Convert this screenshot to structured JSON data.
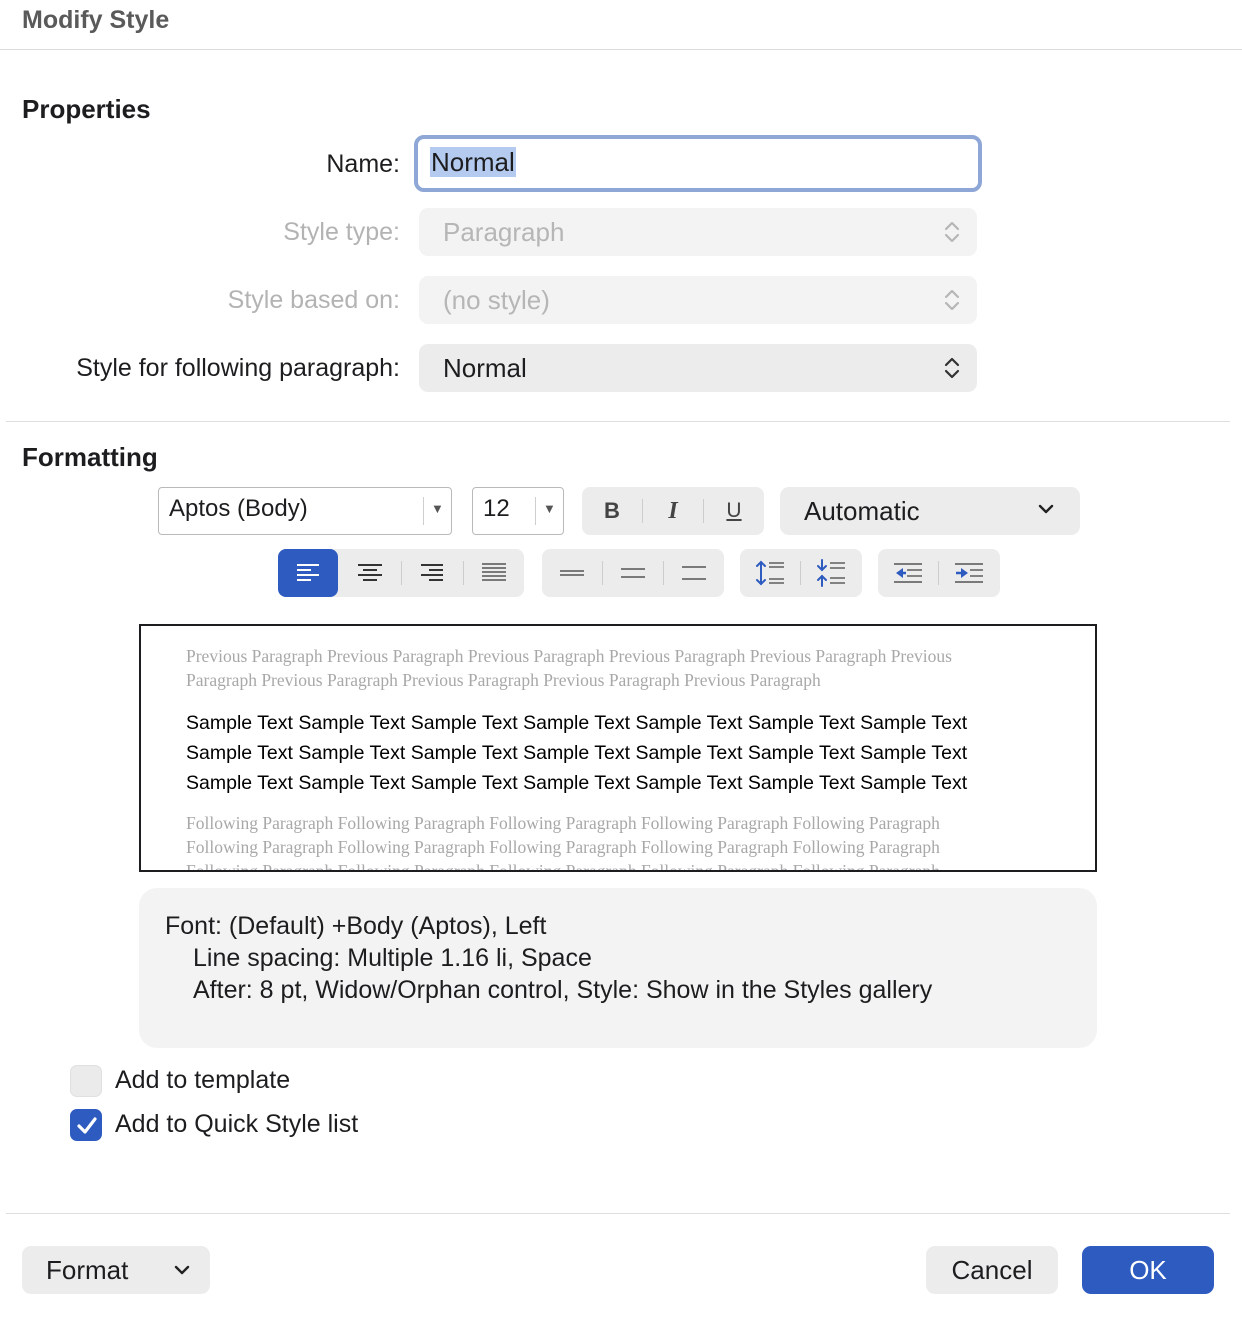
{
  "window": {
    "title": "Modify Style"
  },
  "properties": {
    "section_title": "Properties",
    "name_label": "Name:",
    "name_value": "Normal",
    "style_type_label": "Style type:",
    "style_type_value": "Paragraph",
    "based_on_label": "Style based on:",
    "based_on_value": "(no style)",
    "following_label": "Style for following paragraph:",
    "following_value": "Normal"
  },
  "formatting": {
    "section_title": "Formatting",
    "font_name": "Aptos (Body)",
    "font_size": "12",
    "bold_label": "B",
    "italic_label": "I",
    "underline_label": "U",
    "color_value": "Automatic",
    "alignment_selected": "left",
    "accent_color": "#2e5bc0"
  },
  "preview": {
    "previous_line_1": "Previous Paragraph Previous Paragraph Previous Paragraph Previous Paragraph Previous Paragraph Previous",
    "previous_line_2": "Paragraph Previous Paragraph Previous Paragraph Previous Paragraph Previous Paragraph",
    "sample_line_1": "Sample Text Sample Text Sample Text Sample Text Sample Text Sample Text Sample Text",
    "sample_line_2": "Sample Text Sample Text Sample Text Sample Text Sample Text Sample Text Sample Text",
    "sample_line_3": "Sample Text Sample Text Sample Text Sample Text Sample Text Sample Text Sample Text",
    "following_line_1": "Following Paragraph Following Paragraph Following Paragraph Following Paragraph Following Paragraph",
    "following_line_2": "Following Paragraph Following Paragraph Following Paragraph Following Paragraph Following Paragraph",
    "following_line_3": "Following Paragraph Following Paragraph Following Paragraph Following Paragraph Following Paragraph"
  },
  "description": {
    "line_1": "Font: (Default) +Body (Aptos), Left",
    "line_2": "Line spacing:  Multiple 1.16 li, Space",
    "line_3": "After:  8 pt, Widow/Orphan control, Style: Show in the Styles gallery"
  },
  "options": {
    "add_to_template_label": "Add to template",
    "add_to_template_checked": false,
    "quick_style_label": "Add to Quick Style list",
    "quick_style_checked": true
  },
  "footer": {
    "format_label": "Format",
    "cancel_label": "Cancel",
    "ok_label": "OK"
  }
}
